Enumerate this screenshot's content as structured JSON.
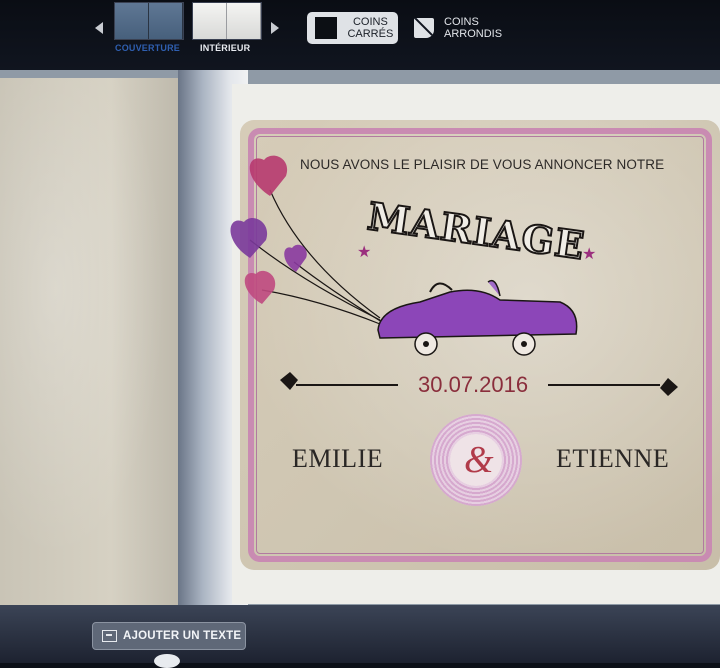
{
  "toolbar": {
    "prev_icon": "chevron-left-icon",
    "next_icon": "chevron-right-icon",
    "views": [
      {
        "label": "COUVERTURE",
        "selected": true
      },
      {
        "label": "INTÉRIEUR",
        "selected": false
      }
    ],
    "corners": {
      "square_line1": "COINS",
      "square_line2": "CARRÉS",
      "rounded_line1": "COINS",
      "rounded_line2": "ARRONDIS"
    }
  },
  "card": {
    "headline": "NOUS AVONS LE PLAISIR DE VOUS ANNONCER NOTRE",
    "title": "MARIAGE",
    "date": "30.07.2016",
    "name_left": "EMILIE",
    "ampersand": "&",
    "name_right": "ETIENNE",
    "accent_color": "#c98bb2"
  },
  "bottom": {
    "add_text_label": "AJOUTER UN TEXTE",
    "add_text_icon": "text-box-icon"
  }
}
